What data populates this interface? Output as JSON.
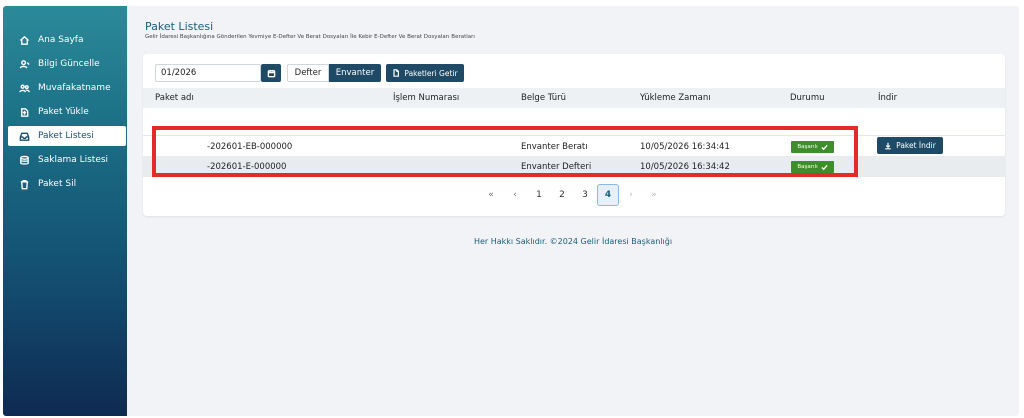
{
  "sidebar": {
    "items": [
      {
        "label": "Ana Sayfa",
        "icon": "home-icon"
      },
      {
        "label": "Bilgi Güncelle",
        "icon": "user-edit-icon"
      },
      {
        "label": "Muvafakatname",
        "icon": "users-icon"
      },
      {
        "label": "Paket Yükle",
        "icon": "upload-icon"
      },
      {
        "label": "Paket Listesi",
        "icon": "inbox-icon",
        "active": true
      },
      {
        "label": "Saklama Listesi",
        "icon": "database-icon"
      },
      {
        "label": "Paket Sil",
        "icon": "trash-icon"
      }
    ]
  },
  "page": {
    "title": "Paket Listesi",
    "subtitle": "Gelir İdaresi Başkanlığına Gönderilen Yevmiye E-Defter Ve Berat Dosyaları İle Kebir E-Defter Ve Berat Dosyaları Beratları"
  },
  "filters": {
    "period_value": "01/2026",
    "type_options": [
      "Defter",
      "Envanter"
    ],
    "selected_type": "Envanter",
    "fetch_label": "Paketleri Getir"
  },
  "table": {
    "headers": [
      "Paket adı",
      "İşlem Numarası",
      "Belge Türü",
      "Yükleme Zamanı",
      "Durumu",
      "İndir"
    ],
    "rows": [
      {
        "paket_adi": "-202601-EB-000000",
        "islem_no": "",
        "belge_turu": "Envanter Beratı",
        "yukleme_zamani": "10/05/2026 16:34:41",
        "durum": "Başarılı"
      },
      {
        "paket_adi": "-202601-E-000000",
        "islem_no": "",
        "belge_turu": "Envanter Defteri",
        "yukleme_zamani": "10/05/2026 16:34:42",
        "durum": "Başarılı"
      }
    ],
    "download_label": "Paket İndir"
  },
  "pagination": {
    "first": "«",
    "prev": "‹",
    "pages": [
      "1",
      "2",
      "3",
      "4"
    ],
    "current": "4",
    "next": "›",
    "last": "»"
  },
  "footer": {
    "text": "Her Hakkı Saklıdır. ©2024 Gelir İdaresi Başkanlığı"
  },
  "colors": {
    "primary": "#1f4a66",
    "success": "#3e8e2b",
    "highlight": "#e52a2a"
  }
}
